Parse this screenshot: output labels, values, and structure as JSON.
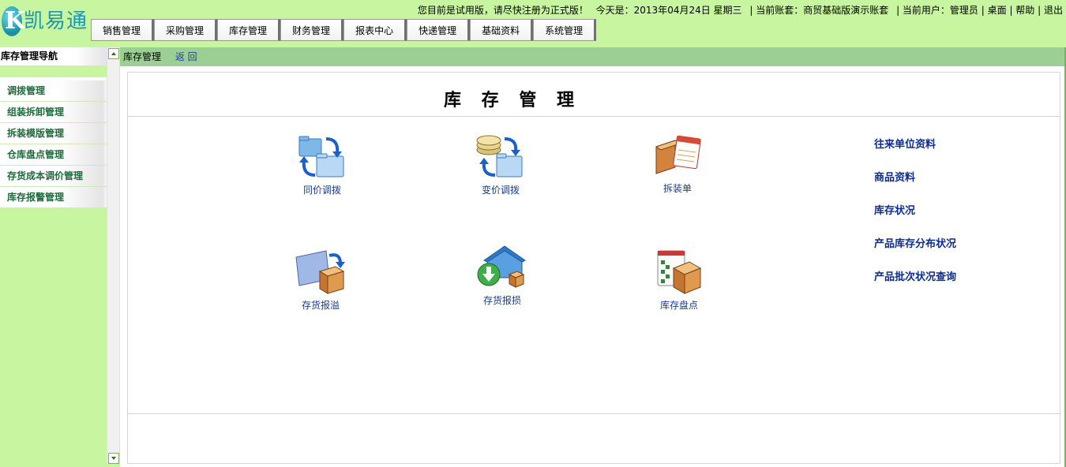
{
  "logo": {
    "letter": "K",
    "text": "凯易通"
  },
  "topbar": {
    "notice": "您目前是试用版，请尽快注册为正式版！",
    "today_label": "今天是：2013年04月24日  星期三",
    "account": "| 当前账套：商贸基础版演示账套",
    "user": "| 当前用户：管理员",
    "desktop": "| 桌面",
    "help": "| 帮助",
    "logout": "| 退出"
  },
  "menu": [
    "销售管理",
    "采购管理",
    "库存管理",
    "财务管理",
    "报表中心",
    "快递管理",
    "基础资料",
    "系统管理"
  ],
  "sidebar": {
    "title": "库存管理导航",
    "items": [
      "调拨管理",
      "组装拆卸管理",
      "拆装模版管理",
      "仓库盘点管理",
      "存货成本调价管理",
      "库存报警管理"
    ]
  },
  "breadcrumb": {
    "current": "库存管理",
    "back": "返 回"
  },
  "panel": {
    "title": "库 存 管 理",
    "tools": [
      {
        "label": "同价调拨",
        "icon": "folder-transfer-icon"
      },
      {
        "label": "变价调拨",
        "icon": "coins-transfer-icon"
      },
      {
        "label": "拆装单",
        "icon": "box-notepad-icon"
      },
      {
        "label": "存货报溢",
        "icon": "box-overflow-icon"
      },
      {
        "label": "存货报损",
        "icon": "house-download-icon"
      },
      {
        "label": "库存盘点",
        "icon": "box-checklist-icon"
      }
    ],
    "links": [
      "往来单位资料",
      "商品资料",
      "库存状况",
      "产品库存分布状况",
      "产品批次状况查询"
    ]
  },
  "colors": {
    "background": "#c8f5a0",
    "breadcrumb_bar": "#9ccf94",
    "nav_text": "#1d6b3a",
    "link_text": "#0c2c8f"
  }
}
